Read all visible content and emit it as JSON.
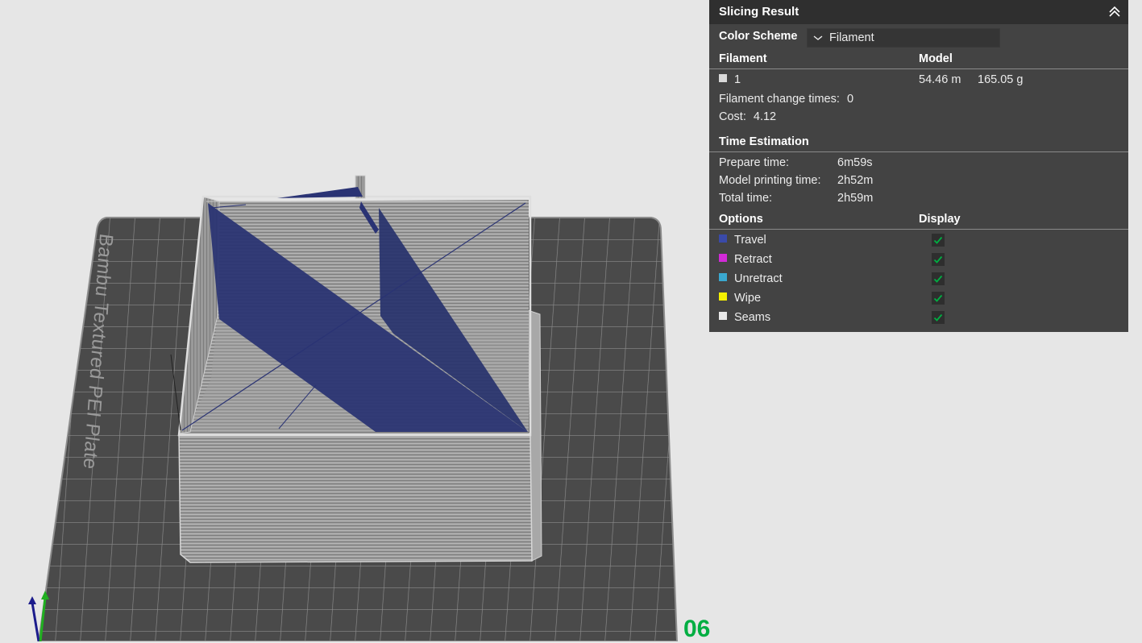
{
  "plate": {
    "label": "Bambu Textured PEI Plate",
    "number": "06"
  },
  "panel": {
    "title": "Slicing Result",
    "color_scheme_label": "Color Scheme",
    "color_scheme_value": "Filament",
    "filament_header": "Filament",
    "model_header": "Model",
    "filaments": [
      {
        "id": "1",
        "color": "#d9d9d9",
        "length": "54.46 m",
        "weight": "165.05 g"
      }
    ],
    "filament_change_label": "Filament change times:",
    "filament_change_value": "0",
    "cost_label": "Cost:",
    "cost_value": "4.12",
    "time_header": "Time Estimation",
    "times": [
      {
        "label": "Prepare time:",
        "value": "6m59s"
      },
      {
        "label": "Model printing time:",
        "value": "2h52m"
      },
      {
        "label": "Total time:",
        "value": "2h59m"
      }
    ],
    "options_header": "Options",
    "display_header": "Display",
    "options": [
      {
        "label": "Travel",
        "color": "#3a4aa8",
        "checked": true
      },
      {
        "label": "Retract",
        "color": "#d22ad8",
        "checked": true
      },
      {
        "label": "Unretract",
        "color": "#3aa8d0",
        "checked": true
      },
      {
        "label": "Wipe",
        "color": "#f4f000",
        "checked": true
      },
      {
        "label": "Seams",
        "color": "#e8e8e8",
        "checked": true
      }
    ]
  }
}
